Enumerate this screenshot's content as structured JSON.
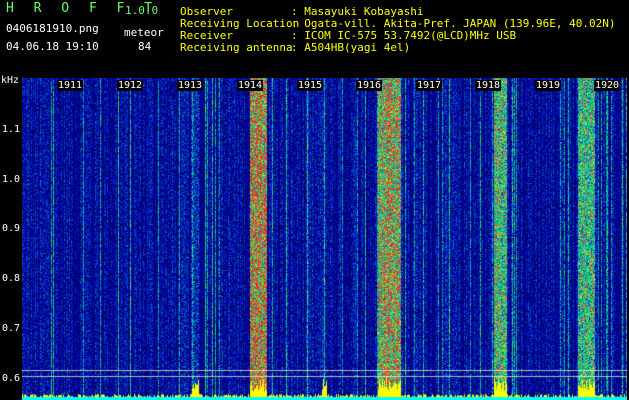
{
  "app": {
    "logo": "H R O F F T",
    "version": "1.0.0"
  },
  "file": {
    "name": "0406181910.png",
    "datetime": "04.06.18 19:10"
  },
  "mode": {
    "label": "meteor",
    "count": "84"
  },
  "station": [
    {
      "label": "Observer",
      "value": ": Masayuki Kobayashi"
    },
    {
      "label": "Receiving Location",
      "value": ": Ogata-vill. Akita-Pref. JAPAN (139.96E, 40.02N)"
    },
    {
      "label": "Receiver",
      "value": ": ICOM IC-575 53.7492(@LCD)MHz USB"
    },
    {
      "label": "Receiving antenna",
      "value": ": A504HB(yagi 4el)"
    }
  ],
  "axis": {
    "y_unit": "kHz",
    "y_ticks": [
      "1.1",
      "1.0",
      "0.9",
      "0.8",
      "0.7",
      "0.6"
    ],
    "minutes": [
      "1911",
      "1912",
      "1913",
      "1914",
      "1915",
      "1916",
      "1917",
      "1918",
      "1919",
      "1920"
    ]
  },
  "colors": {
    "background": "#00004a",
    "text_yellow": "#ffff00",
    "logo_green": "#66ff66"
  }
}
